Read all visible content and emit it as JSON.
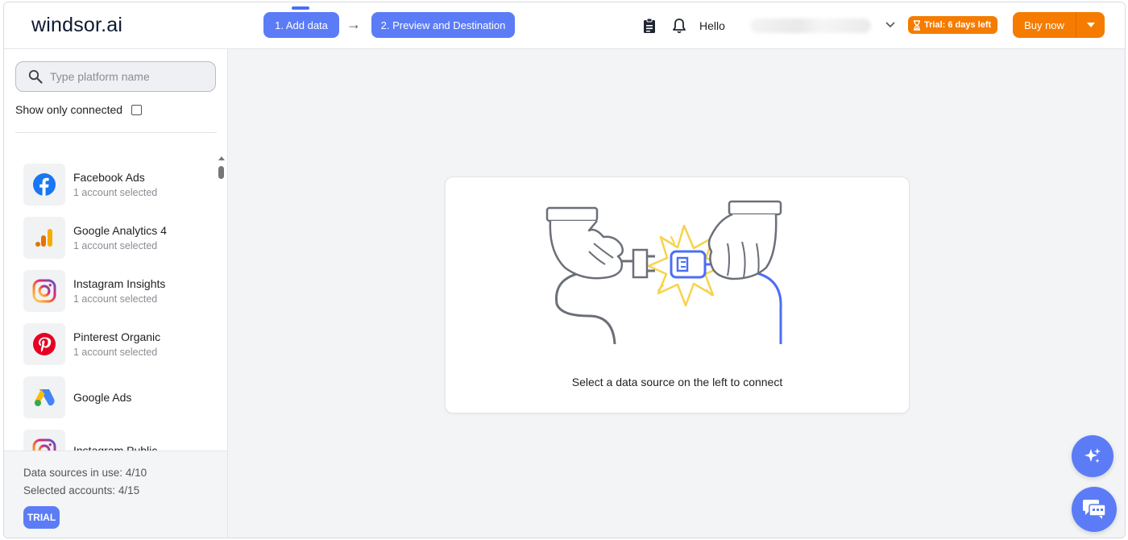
{
  "header": {
    "logo": "windsor.ai",
    "step1_label": "1. Add data",
    "step_arrow": "→",
    "step2_label": "2. Preview and Destination",
    "greeting": "Hello",
    "trial_badge": "Trial: 6 days left",
    "buy_label": "Buy now",
    "icons": [
      "clipboard-icon",
      "bell-icon",
      "chevron-down-icon",
      "hourglass-icon",
      "caret-down-icon"
    ]
  },
  "sidebar": {
    "search_placeholder": "Type platform name",
    "show_connected_label": "Show only connected",
    "show_connected_checked": false,
    "items": [
      {
        "name": "Facebook Ads",
        "sub": "1 account selected",
        "icon": "facebook-icon"
      },
      {
        "name": "Google Analytics 4",
        "sub": "1 account selected",
        "icon": "google-analytics-icon"
      },
      {
        "name": "Instagram Insights",
        "sub": "1 account selected",
        "icon": "instagram-icon"
      },
      {
        "name": "Pinterest Organic",
        "sub": "1 account selected",
        "icon": "pinterest-icon"
      },
      {
        "name": "Google Ads",
        "sub": "",
        "icon": "google-ads-icon"
      },
      {
        "name": "Instagram Public",
        "sub": "",
        "icon": "instagram-icon"
      }
    ],
    "footer": {
      "sources_in_use": "Data sources in use: 4/10",
      "selected_accounts": "Selected accounts: 4/15",
      "plan_chip": "TRIAL"
    }
  },
  "main": {
    "empty_message": "Select a data source on the left to connect"
  },
  "colors": {
    "primary": "#5b7cf6",
    "accent_orange": "#f57c00",
    "background": "#f3f4f6"
  }
}
